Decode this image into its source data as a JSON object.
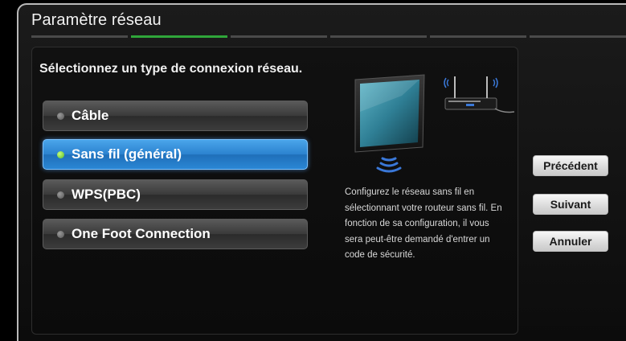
{
  "dialog": {
    "title": "Paramètre réseau",
    "progress": {
      "total_steps": 6,
      "active_step": 2
    }
  },
  "main": {
    "prompt": "Sélectionnez un type de connexion réseau.",
    "options": [
      {
        "label": "Câble",
        "selected": false
      },
      {
        "label": "Sans fil (général)",
        "selected": true
      },
      {
        "label": "WPS(PBC)",
        "selected": false
      },
      {
        "label": "One Foot Connection",
        "selected": false
      }
    ],
    "help_text": "Configurez le réseau sans fil en sélectionnant votre routeur sans fil. En fonction de sa configuration, il vous sera peut-être demandé d'entrer un code de sécurité."
  },
  "buttons": {
    "previous": "Précédent",
    "next": "Suivant",
    "cancel": "Annuler"
  },
  "colors": {
    "selected_option": "#2b82cf",
    "progress_active": "#2fa63a",
    "wifi_waves": "#3a78d8"
  },
  "icons": [
    "tv-screen-icon",
    "router-icon",
    "wifi-waves-icon"
  ]
}
